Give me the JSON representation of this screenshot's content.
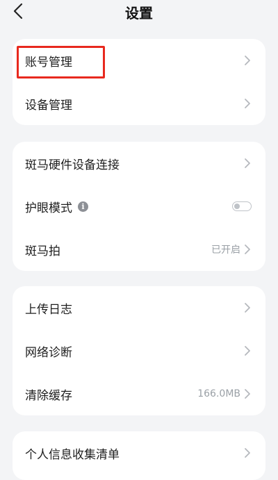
{
  "header": {
    "title": "设置"
  },
  "sections": [
    {
      "items": [
        {
          "label": "账号管理"
        },
        {
          "label": "设备管理"
        }
      ]
    },
    {
      "items": [
        {
          "label": "斑马硬件设备连接"
        },
        {
          "label": "护眼模式",
          "toggle": {
            "on": false
          }
        },
        {
          "label": "斑马拍",
          "value": "已开启"
        }
      ]
    },
    {
      "items": [
        {
          "label": "上传日志"
        },
        {
          "label": "网络诊断"
        },
        {
          "label": "清除缓存",
          "value": "166.0MB"
        }
      ]
    },
    {
      "items": [
        {
          "label": "个人信息收集清单"
        }
      ]
    }
  ],
  "colors": {
    "highlight": "#e8291e",
    "background": "#f3f4f6",
    "card": "#ffffff"
  }
}
